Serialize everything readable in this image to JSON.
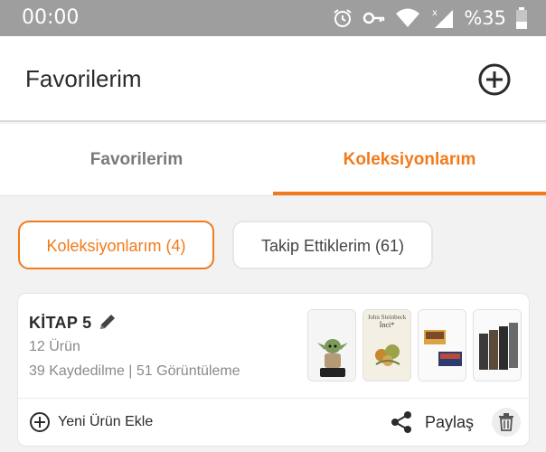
{
  "status_bar": {
    "time": "00:00",
    "battery": "%35",
    "icons": [
      "alarm-icon",
      "key-icon",
      "wifi-icon",
      "signal-icon",
      "battery-icon"
    ]
  },
  "app_bar": {
    "title": "Favorilerim",
    "add_icon": "plus-circle-icon"
  },
  "tabs": [
    {
      "label": "Favorilerim",
      "active": false
    },
    {
      "label": "Koleksiyonlarım",
      "active": true
    }
  ],
  "chips": [
    {
      "label": "Koleksiyonlarım (4)",
      "active": true
    },
    {
      "label": "Takip Ettiklerim (61)",
      "active": false
    }
  ],
  "collection": {
    "title": "KİTAP 5",
    "count": "12 Ürün",
    "stats": "39 Kaydedilme | 51 Görüntüleme",
    "thumb_book_author": "John Steinbeck",
    "thumb_book_title": "İnci*",
    "add_product_label": "Yeni Ürün Ekle",
    "share_label": "Paylaş"
  },
  "colors": {
    "accent": "#f27a1a",
    "status_bar": "#9e9e9e",
    "background": "#f2f2f2"
  }
}
